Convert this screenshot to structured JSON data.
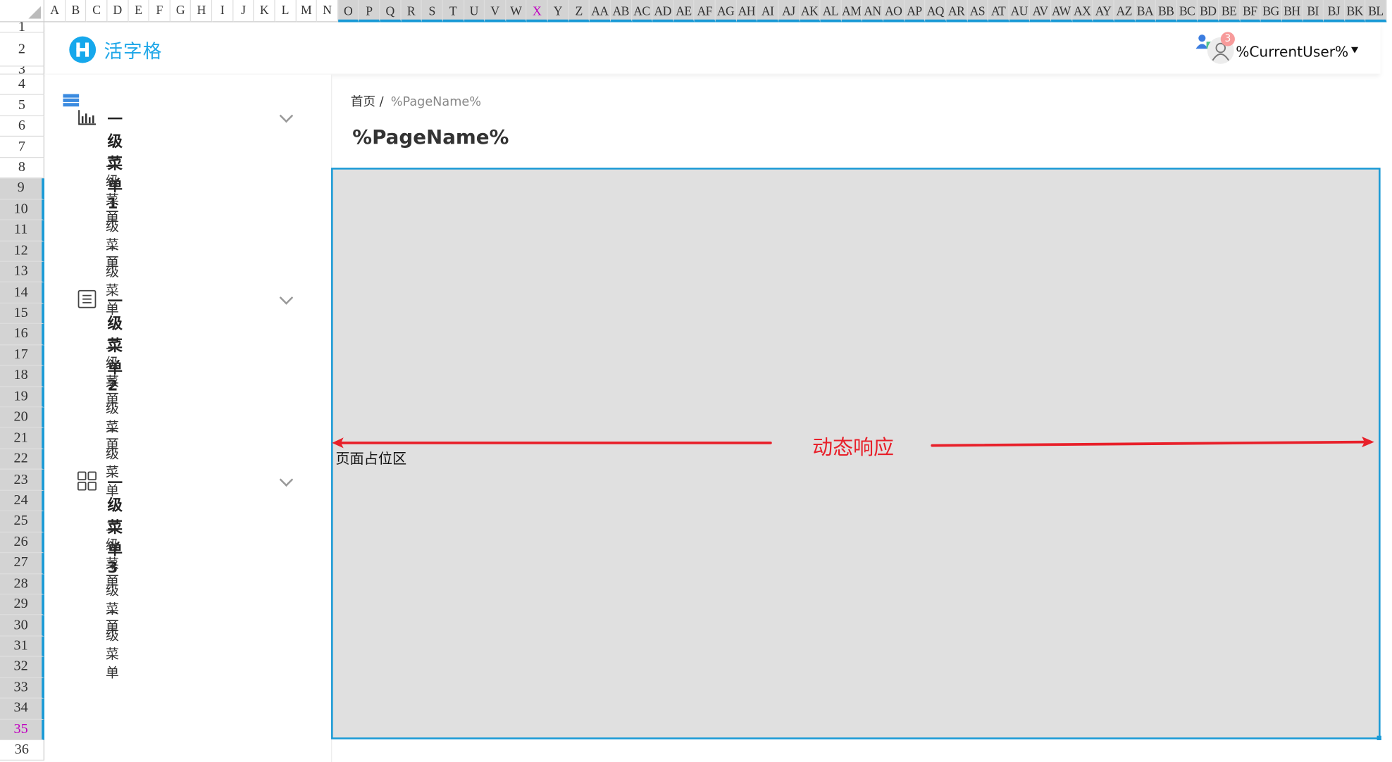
{
  "spreadsheet": {
    "columns": [
      "A",
      "B",
      "C",
      "D",
      "E",
      "F",
      "G",
      "H",
      "I",
      "J",
      "K",
      "L",
      "M",
      "N",
      "O",
      "P",
      "Q",
      "R",
      "S",
      "T",
      "U",
      "V",
      "W",
      "X",
      "Y",
      "Z",
      "AA",
      "AB",
      "AC",
      "AD",
      "AE",
      "AF",
      "AG",
      "AH",
      "AI",
      "AJ",
      "AK",
      "AL",
      "AM",
      "AN",
      "AO",
      "AP",
      "AQ",
      "AR",
      "AS",
      "AT",
      "AU",
      "AV",
      "AW",
      "AX",
      "AY",
      "AZ",
      "BA",
      "BB",
      "BC",
      "BD",
      "BE",
      "BF",
      "BG",
      "BH",
      "BI",
      "BJ",
      "BK",
      "BL"
    ],
    "selected_columns": [
      "O",
      "BL"
    ],
    "active_column": "X",
    "rows": [
      "1",
      "2",
      "3",
      "4",
      "5",
      "6",
      "7",
      "8",
      "9",
      "10",
      "11",
      "12",
      "13",
      "14",
      "15",
      "16",
      "17",
      "18",
      "19",
      "20",
      "21",
      "22",
      "23",
      "24",
      "25",
      "26",
      "27",
      "28",
      "29",
      "30",
      "31",
      "32",
      "33",
      "34",
      "35",
      "36"
    ],
    "selected_rows": [
      9,
      35
    ],
    "active_row": "35",
    "selection_color": "#1a9ad6",
    "active_color": "#c000c0"
  },
  "header": {
    "brand": "活字格",
    "brand_color": "#16a8ec",
    "notification_count": "3",
    "current_user": "%CurrentUser%",
    "dropdown_icon": "caret-down-icon"
  },
  "sidebar": {
    "menus": [
      {
        "label": "一级菜单1",
        "icon": "bar-chart-icon",
        "items": [
          "二级菜单",
          "二级菜单",
          "二级菜单"
        ]
      },
      {
        "label": "一级菜单2",
        "icon": "document-list-icon",
        "items": [
          "二级菜单",
          "二级菜单",
          "二级菜单"
        ]
      },
      {
        "label": "一级菜单3",
        "icon": "grid-icon",
        "items": [
          "二级菜单",
          "二级菜单",
          "二级菜单"
        ]
      }
    ]
  },
  "main": {
    "breadcrumb_home": "首页 /",
    "breadcrumb_current": "%PageName%",
    "page_title": "%PageName%",
    "placeholder_label": "页面占位区",
    "annotation": "动态响应",
    "annotation_color": "#e8202a"
  }
}
